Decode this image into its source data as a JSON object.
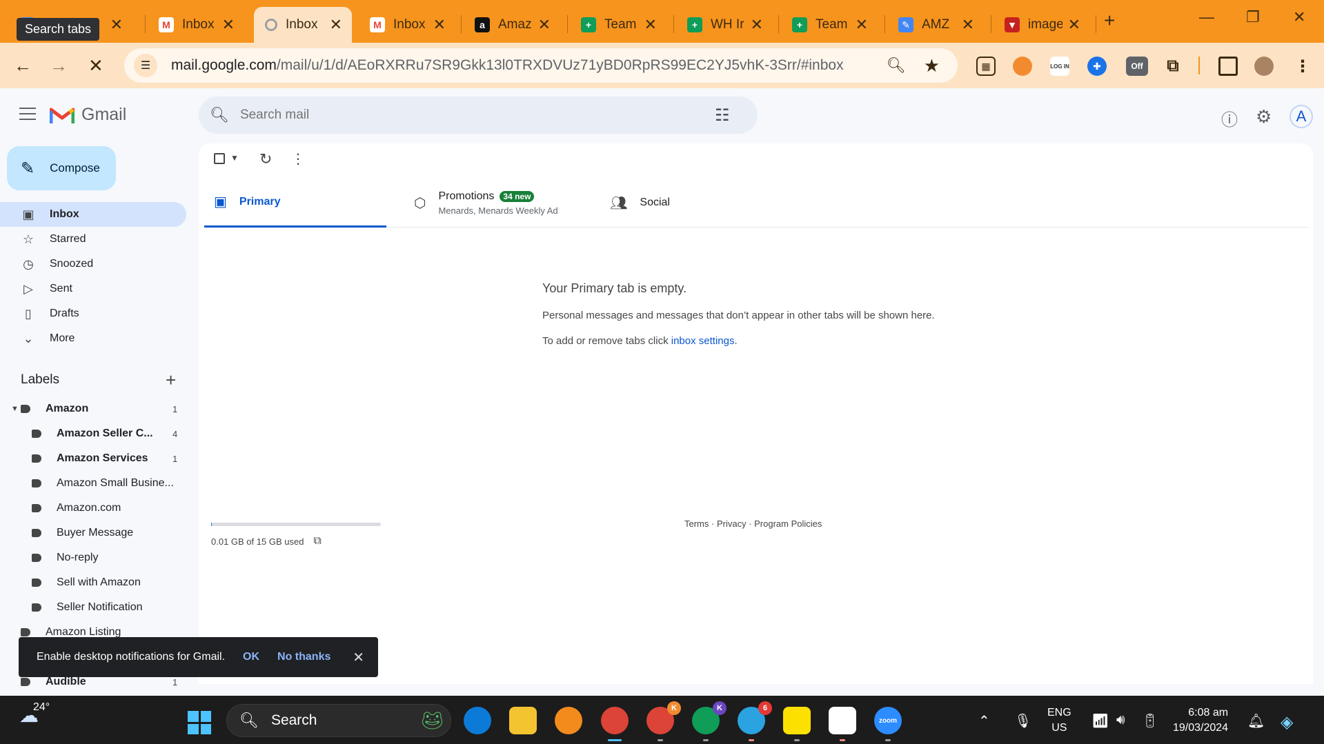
{
  "browser": {
    "tooltip": "Search tabs",
    "tabs": [
      {
        "title": "A",
        "fav": "gmail-icon"
      },
      {
        "title": "Inbox",
        "fav": "gmail-icon"
      },
      {
        "title": "Inbox",
        "fav": "loading-icon"
      },
      {
        "title": "Inbox",
        "fav": "gmail-icon"
      },
      {
        "title": "Amaz",
        "fav": "amazon-icon"
      },
      {
        "title": "Team",
        "fav": "sheets-icon"
      },
      {
        "title": "WH Ir",
        "fav": "sheets-icon"
      },
      {
        "title": "Team",
        "fav": "sheets-icon"
      },
      {
        "title": "AMZ",
        "fav": "pen-icon"
      },
      {
        "title": "image",
        "fav": "image-icon"
      }
    ],
    "new_tab": "+",
    "url_host": "mail.google.com",
    "url_path": "/mail/u/1/d/AEoRXRRu7SR9Gkk13l0TRXDVUz71yBD0RpRS99EC2YJ5vhK-3Srr/#inbox",
    "ext_off_label": "Off"
  },
  "gmail": {
    "logo_text": "Gmail",
    "search_placeholder": "Search mail",
    "account_initial": "A",
    "compose_label": "Compose",
    "nav": [
      {
        "label": "Inbox",
        "icon": "inbox-icon",
        "selected": true
      },
      {
        "label": "Starred",
        "icon": "star-icon"
      },
      {
        "label": "Snoozed",
        "icon": "clock-icon"
      },
      {
        "label": "Sent",
        "icon": "send-icon"
      },
      {
        "label": "Drafts",
        "icon": "draft-icon"
      },
      {
        "label": "More",
        "icon": "chevron-down-icon"
      }
    ],
    "labels_title": "Labels",
    "labels": [
      {
        "name": "Amazon",
        "count": "1",
        "bold": true,
        "level": 0
      },
      {
        "name": "Amazon Seller C...",
        "count": "4",
        "bold": true,
        "level": 1
      },
      {
        "name": "Amazon Services",
        "count": "1",
        "bold": true,
        "level": 1
      },
      {
        "name": "Amazon Small Busine...",
        "count": "",
        "bold": false,
        "level": 1
      },
      {
        "name": "Amazon.com",
        "count": "",
        "bold": false,
        "level": 1
      },
      {
        "name": "Buyer Message",
        "count": "",
        "bold": false,
        "level": 1
      },
      {
        "name": "No-reply",
        "count": "",
        "bold": false,
        "level": 1
      },
      {
        "name": "Sell with Amazon",
        "count": "",
        "bold": false,
        "level": 1
      },
      {
        "name": "Seller Notification",
        "count": "",
        "bold": false,
        "level": 1
      },
      {
        "name": "Amazon Listing",
        "count": "",
        "bold": false,
        "level": 0
      },
      {
        "name": "",
        "count": "",
        "bold": false,
        "level": 0
      },
      {
        "name": "Audible",
        "count": "1",
        "bold": true,
        "level": 0
      }
    ],
    "tabs": {
      "primary": "Primary",
      "promotions": "Promotions",
      "promotions_badge": "34 new",
      "promotions_sub": "Menards, Menards Weekly Ad",
      "social": "Social"
    },
    "empty": {
      "heading": "Your Primary tab is empty.",
      "body": "Personal messages and messages that don’t appear in other tabs will be shown here.",
      "settings_prefix": "To add or remove tabs click ",
      "settings_link": "inbox settings",
      "settings_suffix": "."
    },
    "storage": {
      "text": "0.01 GB of 15 GB used",
      "used_fraction": 0.001
    },
    "footer": {
      "terms": "Terms",
      "privacy": "Privacy",
      "policies": "Program Policies",
      "sep": " · "
    },
    "snackbar": {
      "text": "Enable desktop notifications for Gmail.",
      "ok": "OK",
      "no": "No thanks"
    }
  },
  "taskbar": {
    "temp": "24°",
    "search": "Search",
    "telegram_badge": "6",
    "chrome_k1": "K",
    "chrome_k2": "K",
    "zoom": "zoom",
    "lang1": "ENG",
    "lang2": "US",
    "time": "6:08 am",
    "date": "19/03/2024"
  }
}
